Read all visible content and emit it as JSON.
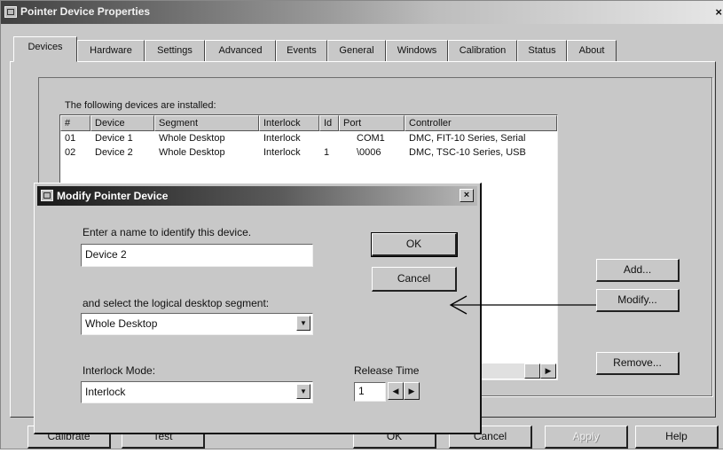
{
  "window": {
    "title": "Pointer Device Properties",
    "close_label": "×",
    "tabs": [
      {
        "label": "Devices",
        "active": true
      },
      {
        "label": "Hardware"
      },
      {
        "label": "Settings"
      },
      {
        "label": "Advanced"
      },
      {
        "label": "Events"
      },
      {
        "label": "General"
      },
      {
        "label": "Windows"
      },
      {
        "label": "Calibration"
      },
      {
        "label": "Status"
      },
      {
        "label": "About"
      }
    ]
  },
  "devices": {
    "intro": "The following devices are installed:",
    "columns": [
      "#",
      "Device",
      "Segment",
      "Interlock",
      "Id",
      "Port",
      "Controller"
    ],
    "rows": [
      [
        "01",
        "Device 1",
        "Whole Desktop",
        "Interlock",
        "",
        "COM1",
        "DMC, FIT-10 Series, Serial"
      ],
      [
        "02",
        "Device 2",
        "Whole Desktop",
        "Interlock",
        "1",
        "\\0006",
        "DMC, TSC-10 Series, USB"
      ]
    ],
    "add_label": "Add...",
    "modify_label": "Modify...",
    "remove_label": "Remove..."
  },
  "footer": {
    "calibrate_label": "Calibrate",
    "test_label": "Test",
    "ok_label": "OK",
    "cancel_label": "Cancel",
    "apply_label": "Apply",
    "help_label": "Help"
  },
  "dialog": {
    "title": "Modify Pointer Device",
    "close_label": "×",
    "name_prompt": "Enter a name to identify this device.",
    "name_value": "Device 2",
    "segment_prompt": "and select the logical desktop segment:",
    "segment_value": "Whole Desktop",
    "interlock_label": "Interlock Mode:",
    "interlock_value": "Interlock",
    "release_label": "Release Time",
    "release_value": "1",
    "ok_label": "OK",
    "cancel_label": "Cancel"
  }
}
